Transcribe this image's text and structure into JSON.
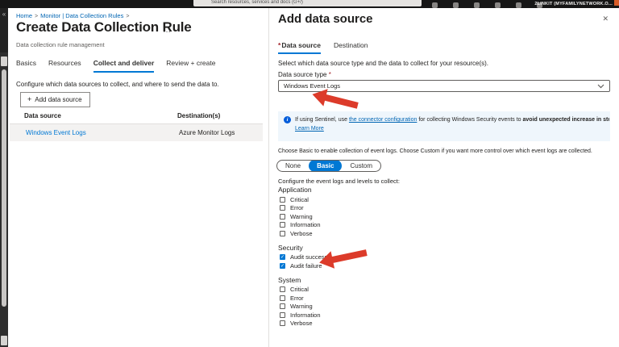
{
  "colors": {
    "accent": "#0078d4",
    "link": "#0065b3",
    "required": "#a4262c",
    "arrow": "#dc3b2a",
    "banner_bg": "#eff6fc"
  },
  "topbar": {
    "search_placeholder": "Search resources, services and docs (G+/)",
    "account_label": "2LINKIT (MYFAMILYNETWORK.O...",
    "icons": [
      "cloud-shell-icon",
      "notifications-icon",
      "settings-icon",
      "help-icon",
      "feedback-icon",
      "account-icon"
    ]
  },
  "nav_rail": {
    "collapse_glyph": "«"
  },
  "left_panel": {
    "breadcrumb": [
      {
        "label": "Home"
      },
      {
        "label": "Monitor | Data Collection Rules"
      }
    ],
    "title": "Create Data Collection Rule",
    "title_menu": "…",
    "subtitle": "Data collection rule management",
    "tabs": [
      {
        "label": "Basics",
        "active": false
      },
      {
        "label": "Resources",
        "active": false
      },
      {
        "label": "Collect and deliver",
        "active": true
      },
      {
        "label": "Review + create",
        "active": false
      }
    ],
    "description": "Configure which data sources to collect, and where to send the data to.",
    "add_button": {
      "icon": "+",
      "label": "Add data source"
    },
    "table": {
      "headers": [
        "Data source",
        "Destination(s)"
      ],
      "rows": [
        {
          "source": "Windows Event Logs",
          "destination": "Azure Monitor Logs",
          "selected": true
        }
      ]
    }
  },
  "panel": {
    "title": "Add data source",
    "close_glyph": "✕",
    "tabs": [
      {
        "label": "Data source",
        "required": true,
        "active": true
      },
      {
        "label": "Destination",
        "required": false,
        "active": false
      }
    ],
    "intro": "Select which data source type and the data to collect for your resource(s).",
    "data_source_type": {
      "label": "Data source type",
      "required_mark": "*",
      "value": "Windows Event Logs"
    },
    "banner": {
      "segments": [
        {
          "text": "If using Sentinel, use ",
          "style": "plain"
        },
        {
          "text": "the connector configuration",
          "style": "link"
        },
        {
          "text": " for collecting Windows Security events to ",
          "style": "plain"
        },
        {
          "text": "avoid unexpected increase in storage cost.",
          "style": "bold"
        }
      ],
      "link2": "Learn More"
    },
    "mode_help": "Choose Basic to enable collection of event logs. Choose Custom if you want more control over which event logs are collected.",
    "mode_toggle": {
      "options": [
        "None",
        "Basic",
        "Custom"
      ],
      "selected": "Basic"
    },
    "configure_help": "Configure the event logs and levels to collect:",
    "log_groups": [
      {
        "name": "Application",
        "levels": [
          {
            "label": "Critical",
            "checked": false
          },
          {
            "label": "Error",
            "checked": false
          },
          {
            "label": "Warning",
            "checked": false
          },
          {
            "label": "Information",
            "checked": false
          },
          {
            "label": "Verbose",
            "checked": false
          }
        ]
      },
      {
        "name": "Security",
        "levels": [
          {
            "label": "Audit success",
            "checked": true
          },
          {
            "label": "Audit failure",
            "checked": true
          }
        ]
      },
      {
        "name": "System",
        "levels": [
          {
            "label": "Critical",
            "checked": false
          },
          {
            "label": "Error",
            "checked": false
          },
          {
            "label": "Warning",
            "checked": false
          },
          {
            "label": "Information",
            "checked": false
          },
          {
            "label": "Verbose",
            "checked": false
          }
        ]
      }
    ]
  }
}
